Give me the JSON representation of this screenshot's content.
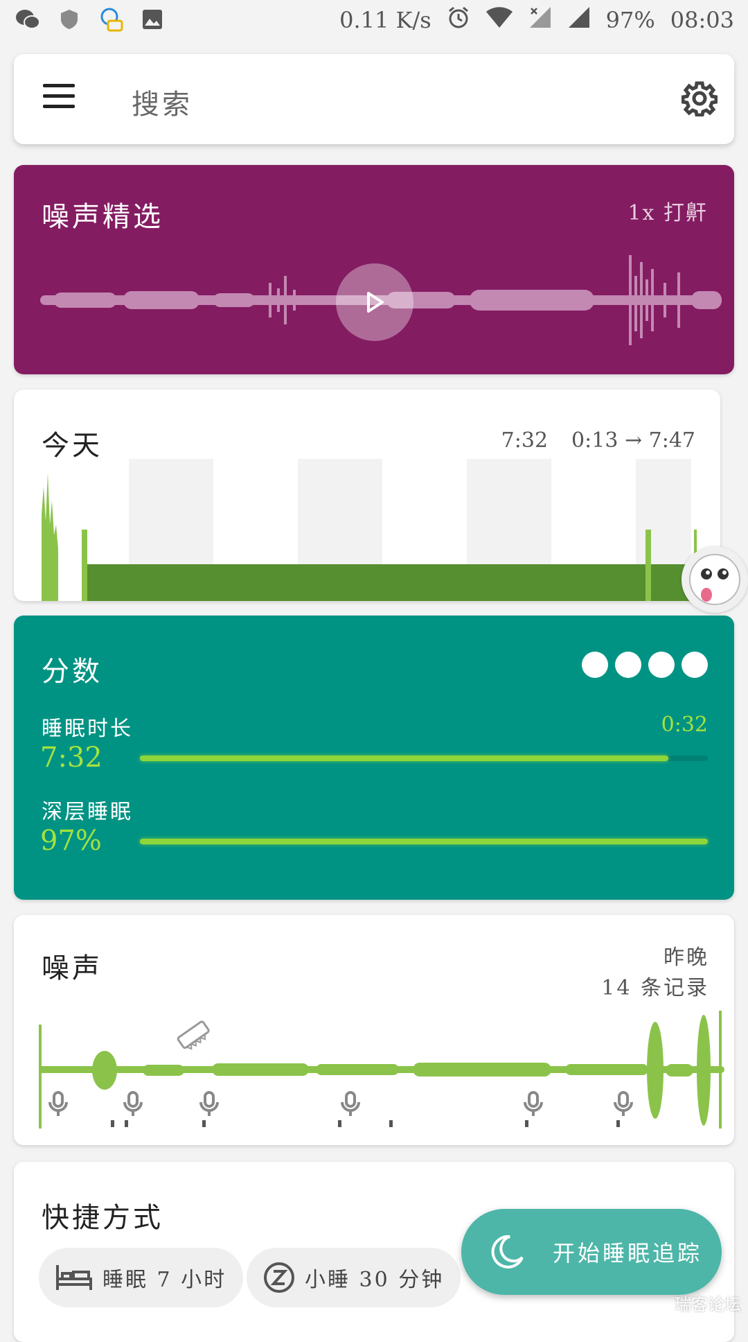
{
  "status_bar": {
    "speed": "0.11 K/s",
    "battery": "97%",
    "time": "08:03",
    "left_icons": [
      "wechat-icon",
      "shield-icon",
      "chat-bot-icon",
      "image-icon"
    ],
    "right_icons": [
      "alarm-icon",
      "wifi-icon",
      "signal-x-icon",
      "signal-icon"
    ]
  },
  "search": {
    "placeholder": "搜索"
  },
  "noise_pick": {
    "title": "噪声精选",
    "tag": "1x 打鼾",
    "bg_color": "#841c62"
  },
  "today": {
    "title": "今天",
    "duration": "7:32",
    "range": "0:13 → 7:47"
  },
  "score": {
    "title": "分数",
    "dots": 4,
    "sleep_length_label": "睡眠时长",
    "sleep_length_value": "7:32",
    "sleep_length_extra": "0:32",
    "sleep_length_progress": 0.93,
    "deep_sleep_label": "深层睡眠",
    "deep_sleep_value": "97%",
    "deep_sleep_progress": 1.0,
    "bg_color": "#009383",
    "accent": "#a5e23f"
  },
  "noise": {
    "title": "噪声",
    "when": "昨晚",
    "count": "14 条记录"
  },
  "shortcuts": {
    "title": "快捷方式",
    "chips": [
      {
        "icon": "bed-icon",
        "label": "睡眠 7 小时"
      },
      {
        "icon": "nap-icon",
        "label": "小睡 30 分钟"
      }
    ]
  },
  "fab": {
    "icon": "moon-icon",
    "label": "开始睡眠追踪"
  },
  "watermark": "瑞客论坛"
}
